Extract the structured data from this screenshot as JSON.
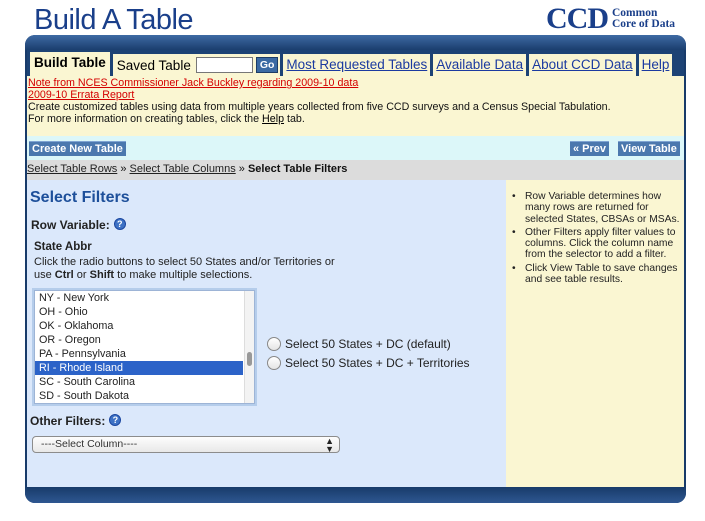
{
  "header": {
    "title": "Build A Table",
    "logo_big": "CCD",
    "logo_line1": "Common",
    "logo_line2": "Core of Data"
  },
  "nav": {
    "tabs": [
      "Build Table",
      "Saved Table",
      "Most Requested Tables",
      "Available Data",
      "About CCD Data",
      "Help"
    ],
    "saved_input_value": "",
    "go_label": "Go"
  },
  "notice": {
    "link1": "Note from NCES Commissioner Jack Buckley regarding 2009-10 data",
    "link2": "2009-10 Errata Report",
    "line1": "Create customized tables using data from multiple years collected from five CCD surveys and a Census Special Tabulation.",
    "line2_pre": "For more information on creating tables, click the ",
    "line2_link": "Help",
    "line2_post": " tab."
  },
  "actions": {
    "create": "Create New Table",
    "prev": "« Prev",
    "view": "View Table"
  },
  "breadcrumb": {
    "step1": "Select Table Rows",
    "sep": " » ",
    "step2": "Select Table Columns",
    "step3": "Select Table Filters"
  },
  "filters": {
    "heading": "Select Filters",
    "row_variable_label": "Row Variable:",
    "state_label": "State Abbr",
    "instr_1": "Click the radio buttons to select 50 States and/or Territories or",
    "instr_2a": "use ",
    "instr_ctrl": "Ctrl",
    "instr_or": " or ",
    "instr_shift": "Shift",
    "instr_2b": " to make multiple selections.",
    "states": [
      "NY - New York",
      "OH - Ohio",
      "OK - Oklahoma",
      "OR - Oregon",
      "PA - Pennsylvania",
      "RI - Rhode Island",
      "SC - South Carolina",
      "SD - South Dakota"
    ],
    "selected_state": "RI - Rhode Island",
    "radio1": "Select 50 States + DC (default)",
    "radio2": "Select 50 States + DC + Territories",
    "other_filters_label": "Other Filters:",
    "select_column": "----Select Column----",
    "help_glyph": "?"
  },
  "sidebar": {
    "tips": [
      "Row Variable determines how many rows are returned for selected States, CBSAs or MSAs.",
      "Other Filters apply filter values to columns. Click the column name from the selector to add a filter.",
      "Click View Table to save changes and see table results."
    ]
  },
  "colors": {
    "brand_blue": "#1a3f8a",
    "frame_navy": "#183b6a",
    "tab_cream": "#faf6d2",
    "selection_blue": "#2c63c8",
    "link_red": "#d40000"
  }
}
